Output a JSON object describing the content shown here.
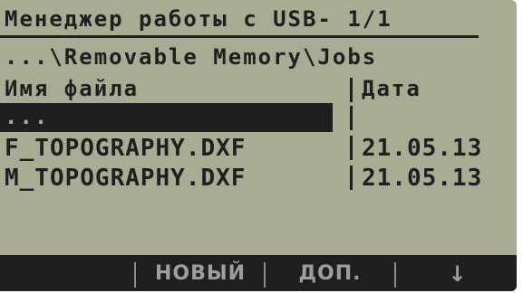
{
  "title": "Менеджер работы с USB- 1/1",
  "path": "...\\Removable Memory\\Jobs",
  "columns": {
    "name": "Имя файла",
    "date": "Дата"
  },
  "rows": [
    {
      "name": "...",
      "date": ""
    },
    {
      "name": "F_TOPOGRAPHY.DXF",
      "date": "21.05.13"
    },
    {
      "name": "M_TOPOGRAPHY.DXF",
      "date": "21.05.13"
    }
  ],
  "softkeys": {
    "new": "НОВЫЙ",
    "more": "ДОП.",
    "down_icon": "arrow-down-icon",
    "down_glyph": "↓"
  },
  "colors": {
    "lcd_background": "#a9ac93",
    "text": "#1f1f1f",
    "softkey_bar": "#1f1f1f",
    "softkey_text": "#9e9e9e"
  }
}
